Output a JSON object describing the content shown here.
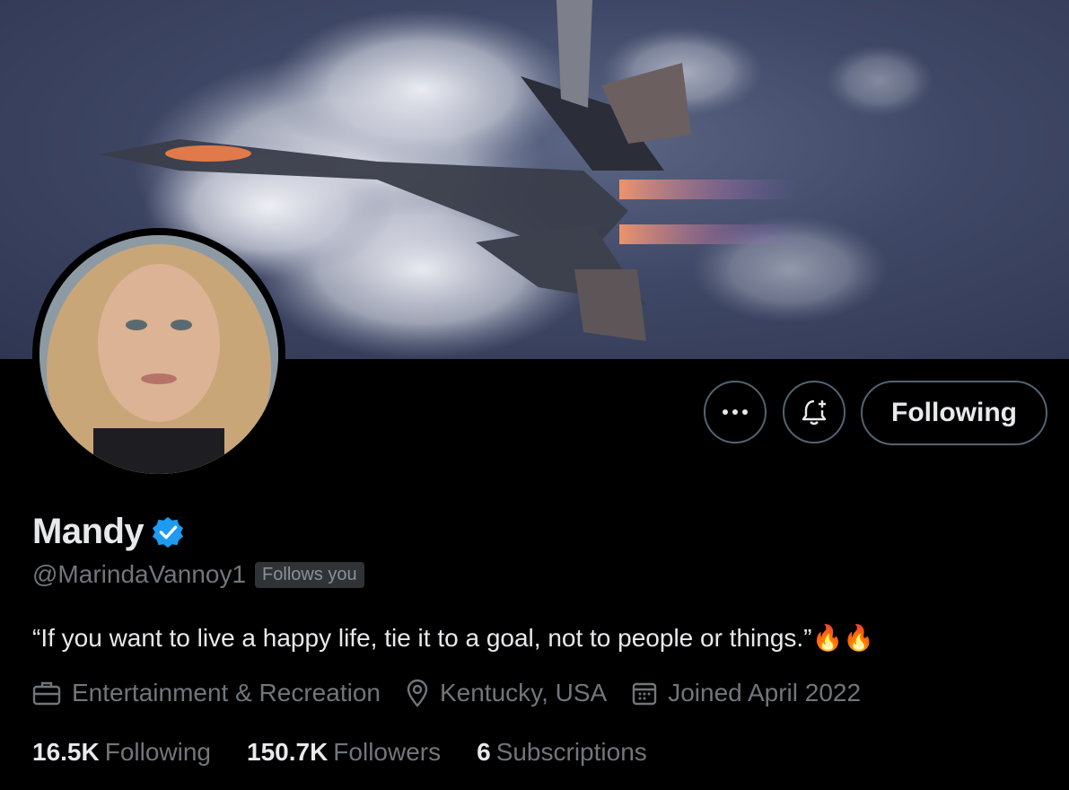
{
  "profile": {
    "display_name": "Mandy",
    "handle": "@MarindaVannoy1",
    "follows_you": "Follows you",
    "bio_text": "“If you want to live a happy life, tie it to a goal, not to people or things.”",
    "bio_emoji": "🔥🔥",
    "category": "Entertainment & Recreation",
    "location": "Kentucky, USA",
    "joined": "Joined April 2022"
  },
  "actions": {
    "more_icon": "more-horizontal-icon",
    "notify_icon": "bell-plus-icon",
    "follow_label": "Following"
  },
  "stats": {
    "following_count": "16.5K",
    "following_label": "Following",
    "followers_count": "150.7K",
    "followers_label": "Followers",
    "subscriptions_count": "6",
    "subscriptions_label": "Subscriptions"
  },
  "colors": {
    "background": "#000000",
    "text_primary": "#e7e9ea",
    "text_secondary": "#71767b",
    "verified_blue": "#1d9bf0",
    "button_border": "#536471"
  }
}
